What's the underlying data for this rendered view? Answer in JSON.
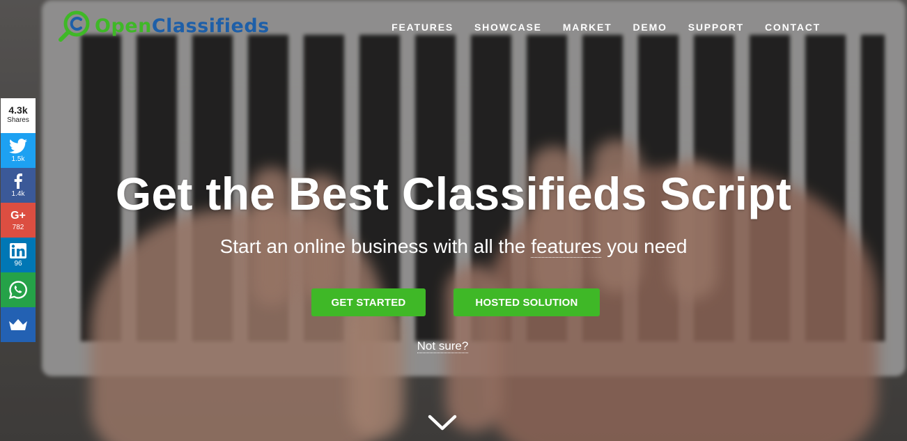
{
  "brand": {
    "name_part1": "Open",
    "name_part2": "Classifieds",
    "colors": {
      "green": "#3fb827",
      "blue": "#1e5fa8"
    }
  },
  "nav": {
    "items": [
      "FEATURES",
      "SHOWCASE",
      "MARKET",
      "DEMO",
      "SUPPORT",
      "CONTACT"
    ]
  },
  "share": {
    "total": "4.3k",
    "total_label": "Shares",
    "twitter": "1.5k",
    "facebook": "1.4k",
    "google_plus_label": "G+",
    "google_plus": "782",
    "linkedin": "96"
  },
  "hero": {
    "title": "Get the Best Classifieds Script",
    "subtitle_before": "Start an online business with all the ",
    "subtitle_link": "features",
    "subtitle_after": " you need",
    "primary_button": "GET STARTED",
    "secondary_button": "HOSTED SOLUTION",
    "help_link": "Not sure?"
  }
}
